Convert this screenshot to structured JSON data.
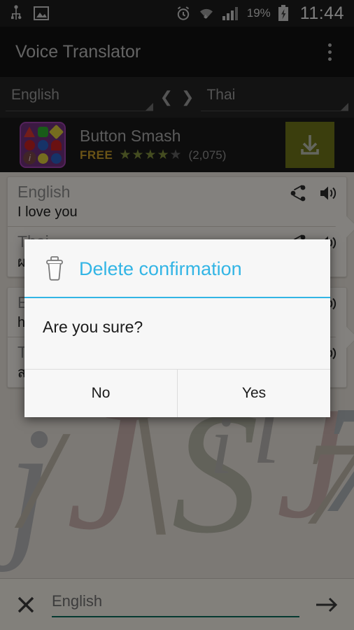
{
  "status_bar": {
    "left_icons": [
      "usb-icon",
      "screenshot-image-icon"
    ],
    "alarm_icon": "alarm-icon",
    "wifi_icon": "wifi-icon",
    "signal_icon": "signal-bars-icon",
    "battery_percent": "19%",
    "battery_icon": "battery-charging-icon",
    "time": "11:44"
  },
  "app_bar": {
    "title": "Voice Translator",
    "overflow_menu": "overflow-menu-icon"
  },
  "language_bar": {
    "source_language": "English",
    "target_language": "Thai",
    "swap_prev": "❮",
    "swap_next": "❯"
  },
  "ad": {
    "title": "Button Smash",
    "price": "FREE",
    "stars_filled": "★★★★",
    "stars_empty": "★",
    "rating_count": "(2,075)",
    "install_icon": "download-icon",
    "info_badge": "i"
  },
  "cards": [
    {
      "rows": [
        {
          "lang": "English",
          "text": "I love you",
          "share_icon": "share-icon",
          "speaker_icon": "speaker-icon"
        },
        {
          "lang": "Thai",
          "text": "ผมรักคุณ",
          "share_icon": "share-icon",
          "speaker_icon": "speaker-icon"
        }
      ]
    },
    {
      "rows": [
        {
          "lang": "English",
          "text": "hello",
          "share_icon": "share-icon",
          "speaker_icon": "speaker-icon"
        },
        {
          "lang": "Thai",
          "text": "สวัสดี",
          "share_icon": "share-icon",
          "speaker_icon": "speaker-icon"
        }
      ]
    }
  ],
  "bottom_bar": {
    "clear_icon": "close-x-icon",
    "input_placeholder": "English",
    "input_value": "",
    "submit_icon": "arrow-right-icon",
    "underline_color": "#0b6b5b"
  },
  "dialog": {
    "icon": "trash-can-icon",
    "title": "Delete confirmation",
    "message": "Are you sure?",
    "buttons": [
      {
        "label": "No"
      },
      {
        "label": "Yes"
      }
    ],
    "accent_color": "#33b5e5"
  }
}
